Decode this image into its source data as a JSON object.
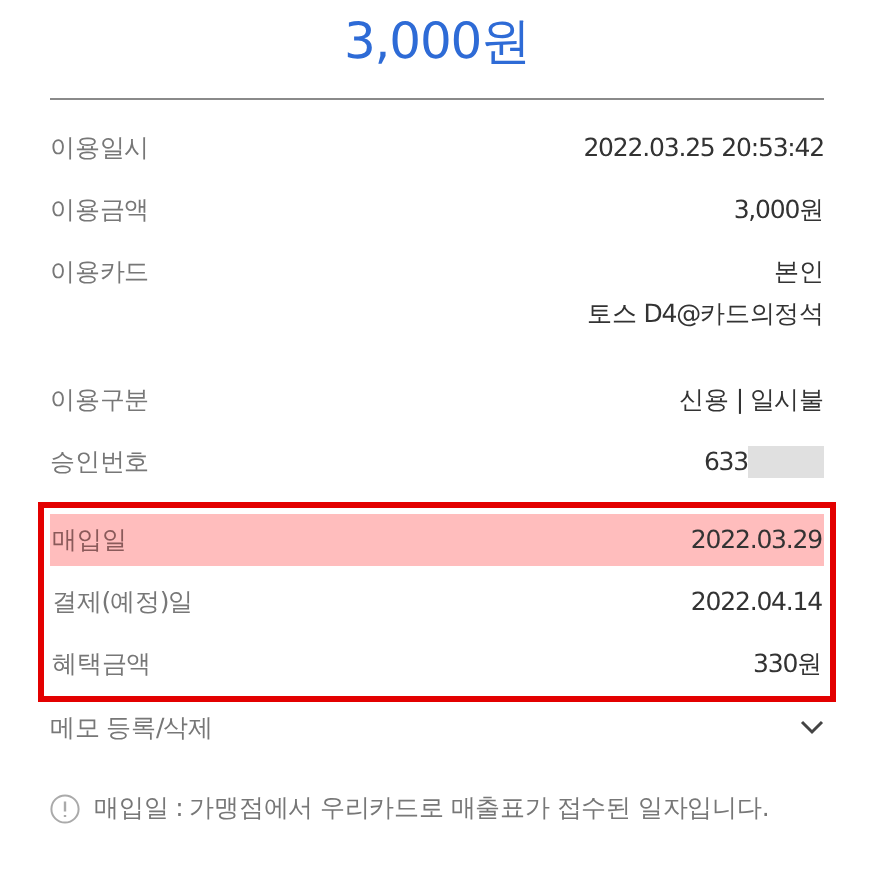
{
  "amount": "3,000원",
  "rows": [
    {
      "label": "이용일시",
      "values": [
        "2022.03.25 20:53:42"
      ],
      "masked": false
    },
    {
      "label": "이용금액",
      "values": [
        "3,000원"
      ],
      "masked": false
    },
    {
      "label": "이용카드",
      "values": [
        "본인",
        "토스 D4@카드의정석"
      ],
      "masked": false
    },
    {
      "label": "이용구분",
      "values": [
        "신용 | 일시불"
      ],
      "masked": false
    },
    {
      "label": "승인번호",
      "values": [
        "633"
      ],
      "masked": true
    }
  ],
  "boxed_rows": [
    {
      "label": "매입일",
      "value": "2022.03.29",
      "highlighted": true
    },
    {
      "label": "결제(예정)일",
      "value": "2022.04.14",
      "highlighted": false
    },
    {
      "label": "혜택금액",
      "value": "330원",
      "highlighted": false
    }
  ],
  "memo": {
    "label": "메모 등록/삭제",
    "expanded": false
  },
  "note": "매입일 : 가맹점에서 우리카드로 매출표가 접수된 일자입니다."
}
